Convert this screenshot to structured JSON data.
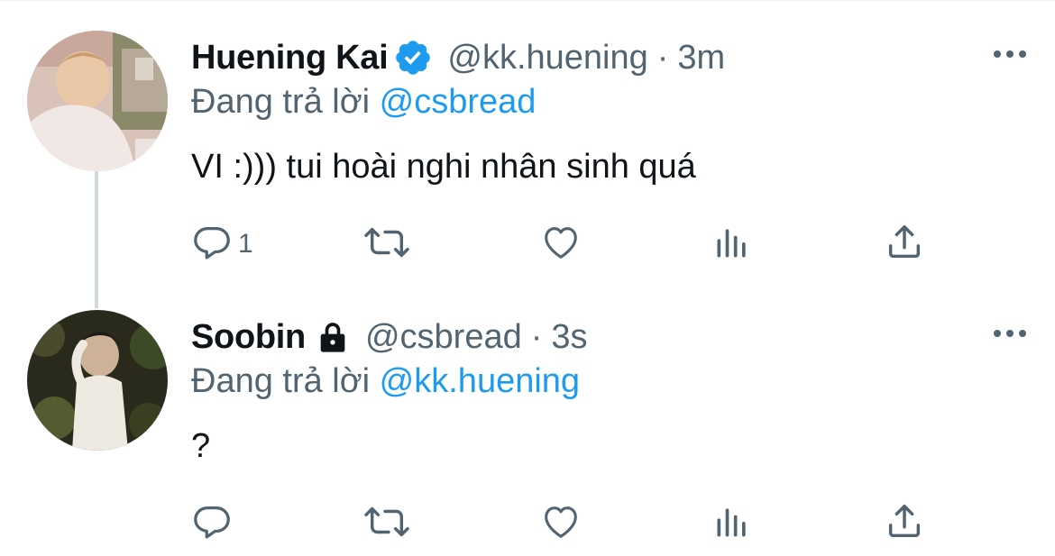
{
  "tweets": [
    {
      "name": "Huening Kai",
      "verified": true,
      "handle": "@kk.huening",
      "separator": "·",
      "time": "3m",
      "replying_prefix": "Đang trả lời",
      "replying_to": "@csbread",
      "text": "VI :))) tui hoài nghi nhân sinh quá",
      "reply_count": "1"
    },
    {
      "name": "Soobin",
      "protected": true,
      "handle": "@csbread",
      "separator": "·",
      "time": "3s",
      "replying_prefix": "Đang trả lời",
      "replying_to": "@kk.huening",
      "text": "?",
      "reply_count": ""
    }
  ],
  "colors": {
    "text": "#0f1419",
    "secondary": "#536471",
    "accent": "#1d9bf0",
    "thread_line": "#cfd9de"
  },
  "icons": [
    "verified-badge-icon",
    "lock-icon",
    "more-icon",
    "reply-icon",
    "retweet-icon",
    "like-icon",
    "views-icon",
    "share-icon"
  ]
}
